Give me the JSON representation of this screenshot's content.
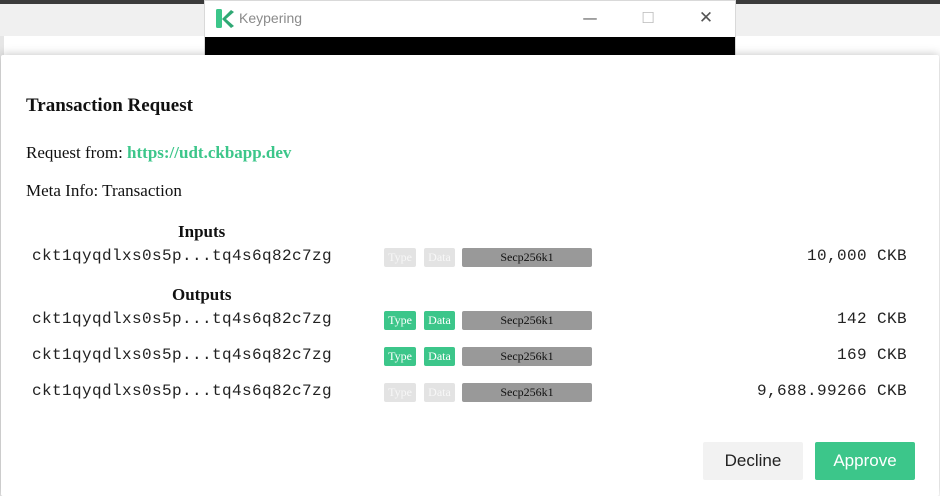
{
  "window": {
    "title": "Keypering",
    "minimize_glyph": "—",
    "maximize_glyph": "☐",
    "close_glyph": "✕",
    "brand_color": "#3cc68a"
  },
  "dialog": {
    "title": "Transaction Request",
    "request_from_label": "Request from:",
    "request_from_url": "https://udt.ckbapp.dev",
    "meta_info": "Meta Info: Transaction",
    "inputs_label": "Inputs",
    "outputs_label": "Outputs",
    "inputs": [
      {
        "address": "ckt1qyqdlxs0s5p...tq4s6q82c7zg",
        "type_label": "Type",
        "type_active": false,
        "data_label": "Data",
        "data_active": false,
        "lock": "Secp256k1",
        "amount": "10,000 CKB"
      }
    ],
    "outputs": [
      {
        "address": "ckt1qyqdlxs0s5p...tq4s6q82c7zg",
        "type_label": "Type",
        "type_active": true,
        "data_label": "Data",
        "data_active": true,
        "lock": "Secp256k1",
        "amount": "142 CKB"
      },
      {
        "address": "ckt1qyqdlxs0s5p...tq4s6q82c7zg",
        "type_label": "Type",
        "type_active": true,
        "data_label": "Data",
        "data_active": true,
        "lock": "Secp256k1",
        "amount": "169 CKB"
      },
      {
        "address": "ckt1qyqdlxs0s5p...tq4s6q82c7zg",
        "type_label": "Type",
        "type_active": false,
        "data_label": "Data",
        "data_active": false,
        "lock": "Secp256k1",
        "amount": "9,688.99266 CKB"
      }
    ],
    "decline_label": "Decline",
    "approve_label": "Approve",
    "accent_color": "#3cc68a",
    "inactive_tag_color": "#e3e3e3",
    "lock_tag_color": "#999999"
  }
}
